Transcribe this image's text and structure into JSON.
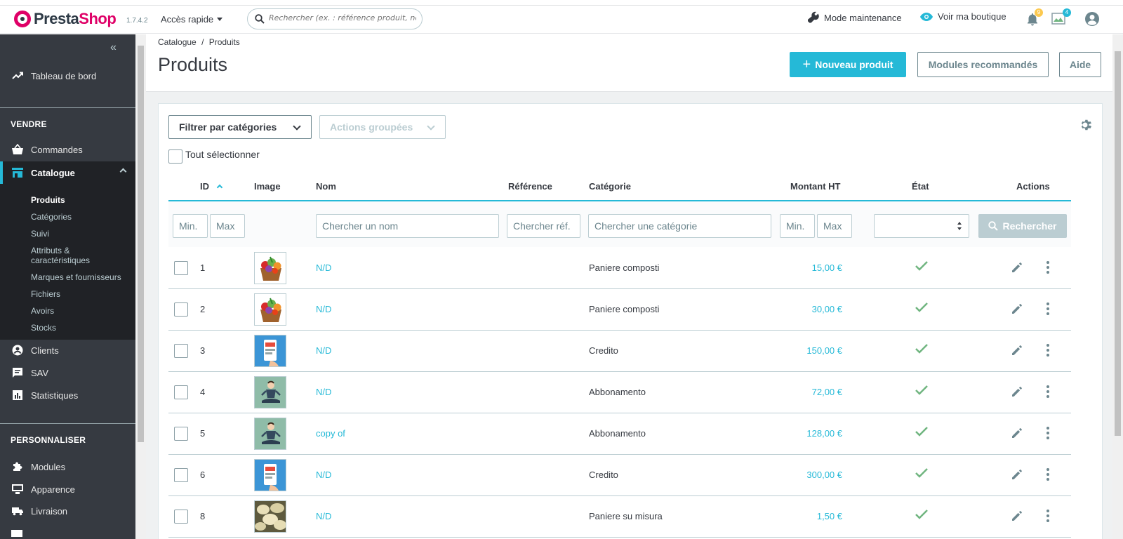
{
  "header": {
    "logo_part1": "Presta",
    "logo_part2": "Shop",
    "version": "1.7.4.2",
    "quick_access": "Accès rapide",
    "search_placeholder": "Rechercher (ex. : référence produit, nom",
    "maintenance": "Mode maintenance",
    "view_shop": "Voir ma boutique",
    "notif_count": "9",
    "orders_count": "4"
  },
  "sidebar": {
    "dashboard": "Tableau de bord",
    "section_sell": "VENDRE",
    "orders": "Commandes",
    "catalog": "Catalogue",
    "catalog_sub": [
      "Produits",
      "Catégories",
      "Suivi",
      "Attributs &",
      "caractéristiques",
      "Marques et fournisseurs",
      "Fichiers",
      "Avoirs",
      "Stocks"
    ],
    "customers": "Clients",
    "sav": "SAV",
    "stats": "Statistiques",
    "section_customize": "PERSONNALISER",
    "modules": "Modules",
    "appearance": "Apparence",
    "shipping": "Livraison"
  },
  "page": {
    "breadcrumb_parent": "Catalogue",
    "breadcrumb_sep": "/",
    "breadcrumb_current": "Produits",
    "title": "Produits",
    "new_product": "Nouveau produit",
    "recommended_modules": "Modules recommandés",
    "help": "Aide"
  },
  "toolbar": {
    "filter_categories": "Filtrer par catégories",
    "bulk_actions": "Actions groupées",
    "select_all": "Tout sélectionner"
  },
  "table": {
    "headers": {
      "id": "ID",
      "image": "Image",
      "name": "Nom",
      "reference": "Référence",
      "category": "Catégorie",
      "price": "Montant HT",
      "state": "État",
      "actions": "Actions"
    },
    "filters": {
      "id_min": "Min.",
      "id_max": "Max",
      "name": "Chercher un nom",
      "reference": "Chercher réf.",
      "category": "Chercher une catégorie",
      "price_min": "Min.",
      "price_max": "Max",
      "search_button": "Rechercher"
    },
    "rows": [
      {
        "id": "1",
        "name": "N/D",
        "category": "Paniere composti",
        "price": "15,00 €",
        "image": "vegetable-basket"
      },
      {
        "id": "2",
        "name": "N/D",
        "category": "Paniere composti",
        "price": "30,00 €",
        "image": "vegetable-basket"
      },
      {
        "id": "3",
        "name": "N/D",
        "category": "Credito",
        "price": "150,00 €",
        "image": "phone-app"
      },
      {
        "id": "4",
        "name": "N/D",
        "category": "Abbonamento",
        "price": "72,00 €",
        "image": "meditating-man"
      },
      {
        "id": "5",
        "name": "copy of",
        "category": "Abbonamento",
        "price": "128,00 €",
        "image": "meditating-man"
      },
      {
        "id": "6",
        "name": "N/D",
        "category": "Credito",
        "price": "300,00 €",
        "image": "phone-app"
      },
      {
        "id": "8",
        "name": "N/D",
        "category": "Paniere su misura",
        "price": "1,50 €",
        "image": "mushrooms"
      }
    ]
  },
  "colors": {
    "accent": "#25b9d7",
    "sidebar_bg": "#363a41",
    "success": "#70b580"
  }
}
